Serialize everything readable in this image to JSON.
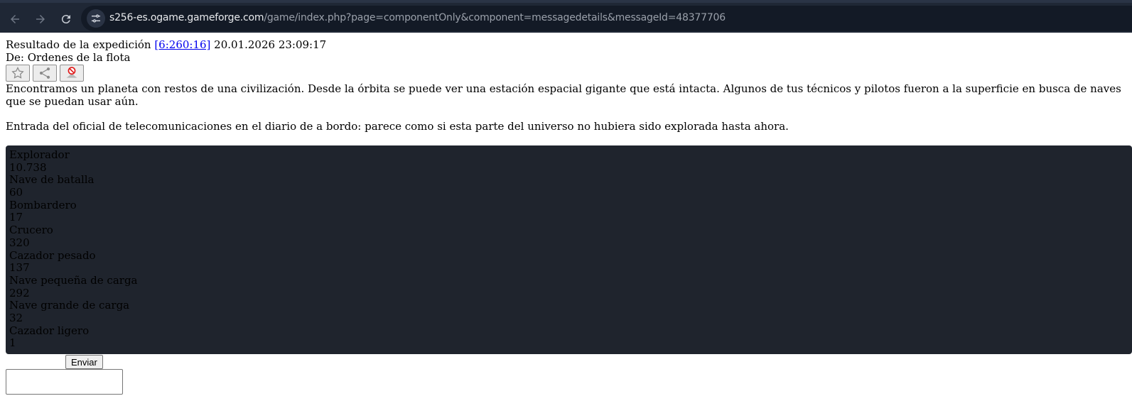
{
  "browser": {
    "url_domain": "s256-es.ogame.gameforge.com",
    "url_path": "/game/index.php?page=componentOnly&component=messagedetails&messageId=48377706"
  },
  "message": {
    "title_prefix": "Resultado de la expedición ",
    "coords": "[6:260:16]",
    "timestamp": " 20.01.2026 23:09:17",
    "from": "De: Ordenes de la flota",
    "paragraphs": [
      "Encontramos un planeta con restos de una civilización. Desde la órbita se puede ver una estación espacial gigante que está intacta. Algunos de tus técnicos y pilotos fueron a la superficie en busca de naves que se puedan usar aún.",
      "Entrada del oficial de telecomunicaciones en el diario de a bordo: parece como si esta parte del universo no hubiera sido explorada hasta ahora."
    ]
  },
  "fleet": [
    {
      "name": "Explorador",
      "amount": "10.738"
    },
    {
      "name": "Nave de batalla",
      "amount": "60"
    },
    {
      "name": "Bombardero",
      "amount": "17"
    },
    {
      "name": "Crucero",
      "amount": "320"
    },
    {
      "name": "Cazador pesado",
      "amount": "137"
    },
    {
      "name": "Nave pequeña de carga",
      "amount": "292"
    },
    {
      "name": "Nave grande de carga",
      "amount": "32"
    },
    {
      "name": "Cazador ligero",
      "amount": "1"
    }
  ],
  "reply": {
    "send_label": "Enviar"
  },
  "icons": {
    "back": "arrow-left-icon",
    "forward": "arrow-right-icon",
    "reload": "reload-icon",
    "site_info": "tune-icon",
    "favorite": "star-icon",
    "share": "share-icon",
    "block": "block-icon"
  },
  "colors": {
    "browser_bar": "#1f2735",
    "omnibox": "#131a26",
    "fleet_panel": "#1f242d",
    "link": "#0000ee"
  }
}
